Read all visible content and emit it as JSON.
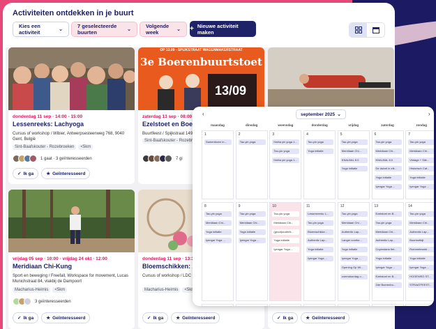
{
  "header": {
    "title": "Activiteiten ontdekken in je buurt",
    "filters": [
      {
        "label": "Kies een activiteit"
      },
      {
        "label": "7 geselecteerde buurten"
      },
      {
        "label": "Volgende week"
      }
    ],
    "new_button": "Nieuwe activiteit maken",
    "icons": {
      "grid": "grid-view-icon",
      "calendar": "calendar-view-icon"
    }
  },
  "cards": [
    {
      "date": "donderdag 11 sep · 14:00 - 15:00",
      "title": "Lessenreeks: Lachyoga",
      "desc": "Cursus of workshop / Wibier, Antwerpsesteenweg 768, 9040 Gent, België",
      "tags": [
        "Sint-Baafskouter - Rozebroeken",
        "<5km"
      ],
      "social": "1 gaat · 3 geïnteresseerden",
      "go": "Ik ga",
      "interested": "Geïnteresseerd"
    },
    {
      "date": "zaterdag 13 sep · 08:00 - 1",
      "title": "Ezelstoet en Boerenbu",
      "desc": "Buurtfeest / Spijkstraat 149",
      "tags": [
        "Sint-Baafskouter - Rozebro"
      ],
      "social": "7 gi",
      "go": "Ik ga",
      "interested": "Geïnteresseerd",
      "poster_top": "OP 13.09 - SPIJKSTRAAT WAGENMAKERSTRAAT",
      "poster_title": "3e Boerenbuurtstoet",
      "poster_date": "13/09"
    },
    {
      "date": "vrijdag 05 sep · 10:00 - vrijdag 24 okt · 12:00",
      "title": "Meridiaan Chi-Kung",
      "desc": "Sport en beweging / Freefall, Workspace for movement, Lucas Munichstraat 84, vlakbij de Dampoort",
      "tags": [
        "Macharius-Heirnis",
        "<5km"
      ],
      "social": "3 geïnteresseerden",
      "go": "Ik ga",
      "interested": "Geïnteresseerd"
    },
    {
      "date": "donderdag 11 sep · 13:30 - 1",
      "title": "Bloemschikken: zome",
      "desc": "Cursus of workshop / LDC E Louisbergskaai 12 · Gent",
      "tags": [
        "Macharius-Heirnis",
        "<5km"
      ],
      "go": "Ik ga",
      "interested": "Geïnteresseerd"
    },
    {
      "go": "Ik ga",
      "interested": "Geïnteresseerd"
    }
  ],
  "calendar": {
    "month": "september 2025",
    "weekdays": [
      "maandag",
      "dinsdag",
      "woensdag",
      "donderdag",
      "vrijdag",
      "zaterdag",
      "zondag"
    ],
    "weeks": [
      [
        {
          "day": "1",
          "events": [
            "Samenlezen in..."
          ]
        },
        {
          "day": "2",
          "events": [
            "Tao-yin yoga"
          ]
        },
        {
          "day": "3",
          "events": [
            "Hatha yin yoga 1...",
            "Tao-yin yoga",
            "Hatha yin yoga 1..."
          ]
        },
        {
          "day": "4",
          "events": [
            "Tao-yin yoga",
            "Yoga initiatie"
          ]
        },
        {
          "day": "5",
          "events": [
            "Tao-yin yoga",
            "Meridiaan Chi...",
            "KNALBAL 8.0",
            "Yoga initiatie"
          ]
        },
        {
          "day": "6",
          "events": [
            "Tao-yin yoga",
            "Meridiaan Chi...",
            "KNALBAL 8.0",
            "De duivel in elk...",
            "Yoga initiatie",
            "Iyengar Yoga ..."
          ]
        },
        {
          "day": "7",
          "events": [
            "Tao-yin yoga",
            "Meridiaan Chi...",
            "Vintage + Sile...",
            "Historisch Caf...",
            "Yoga initiatie",
            "Iyengar Yoga ..."
          ]
        }
      ],
      [
        {
          "day": "8",
          "events": [
            "Tao-yin yoga",
            "Meridiaan Chi...",
            "Yoga initiatie",
            "Iyengar Yoga ..."
          ]
        },
        {
          "day": "9",
          "events": [
            "Tao-yin yoga",
            "Meridiaan Chi...",
            "Yoga initiatie",
            "Iyengar Yoga ..."
          ]
        },
        {
          "day": "10",
          "events": [
            "Tao-yin yoga",
            "Meridiaan Chi...",
            "(groot)ouder/k...",
            "Yoga initiatie",
            "Iyengar Yoga ..."
          ]
        },
        {
          "day": "11",
          "events": [
            "Lessenreeks: L...",
            "Tao-yin yoga",
            "Bloemschikke...",
            "Authentic Lap...",
            "Yoga initiatie",
            "Iyengar Yoga ..."
          ]
        },
        {
          "day": "12",
          "events": [
            "Tao-yin yoga",
            "Meridiaan Chi...",
            "Authentic Lap...",
            "Langer comfor...",
            "Yoga initiatie",
            "Iyengar Yoga ...",
            "Opening Op Wi...",
            "zoemdoordag o..."
          ]
        },
        {
          "day": "13",
          "events": [
            "Ezelstoet en B...",
            "Tao-yin yoga",
            "Meridiaan Chi...",
            "Authentic Lap...",
            "Coyendans fiet...",
            "Yoga initiatie",
            "Iyengar Yoga ...",
            "Ezelstoet en B...",
            "Zde Boerenbu..."
          ]
        },
        {
          "day": "14",
          "events": [
            "Tao-yin yoga",
            "Meridiaan Chi...",
            "Authentic Lap...",
            "Buurtontbijt",
            "Rommelmarkt ...",
            "Yoga initiatie",
            "Iyengar Yoga ...",
            "HOGEWEG ST...",
            "STRAATFEEST..."
          ]
        }
      ],
      [
        {
          "day": "15",
          "events": []
        },
        {
          "day": "16",
          "events": []
        },
        {
          "day": "17",
          "events": []
        },
        {
          "day": "18",
          "events": []
        },
        {
          "day": "19",
          "events": []
        },
        {
          "day": "20",
          "events": []
        },
        {
          "day": "21",
          "events": []
        }
      ]
    ],
    "today": "10"
  },
  "colors": {
    "accent": "#d2185e",
    "navy": "#1f2266",
    "pink_bg": "#e6487a",
    "dark_bg": "#1c1a63"
  }
}
